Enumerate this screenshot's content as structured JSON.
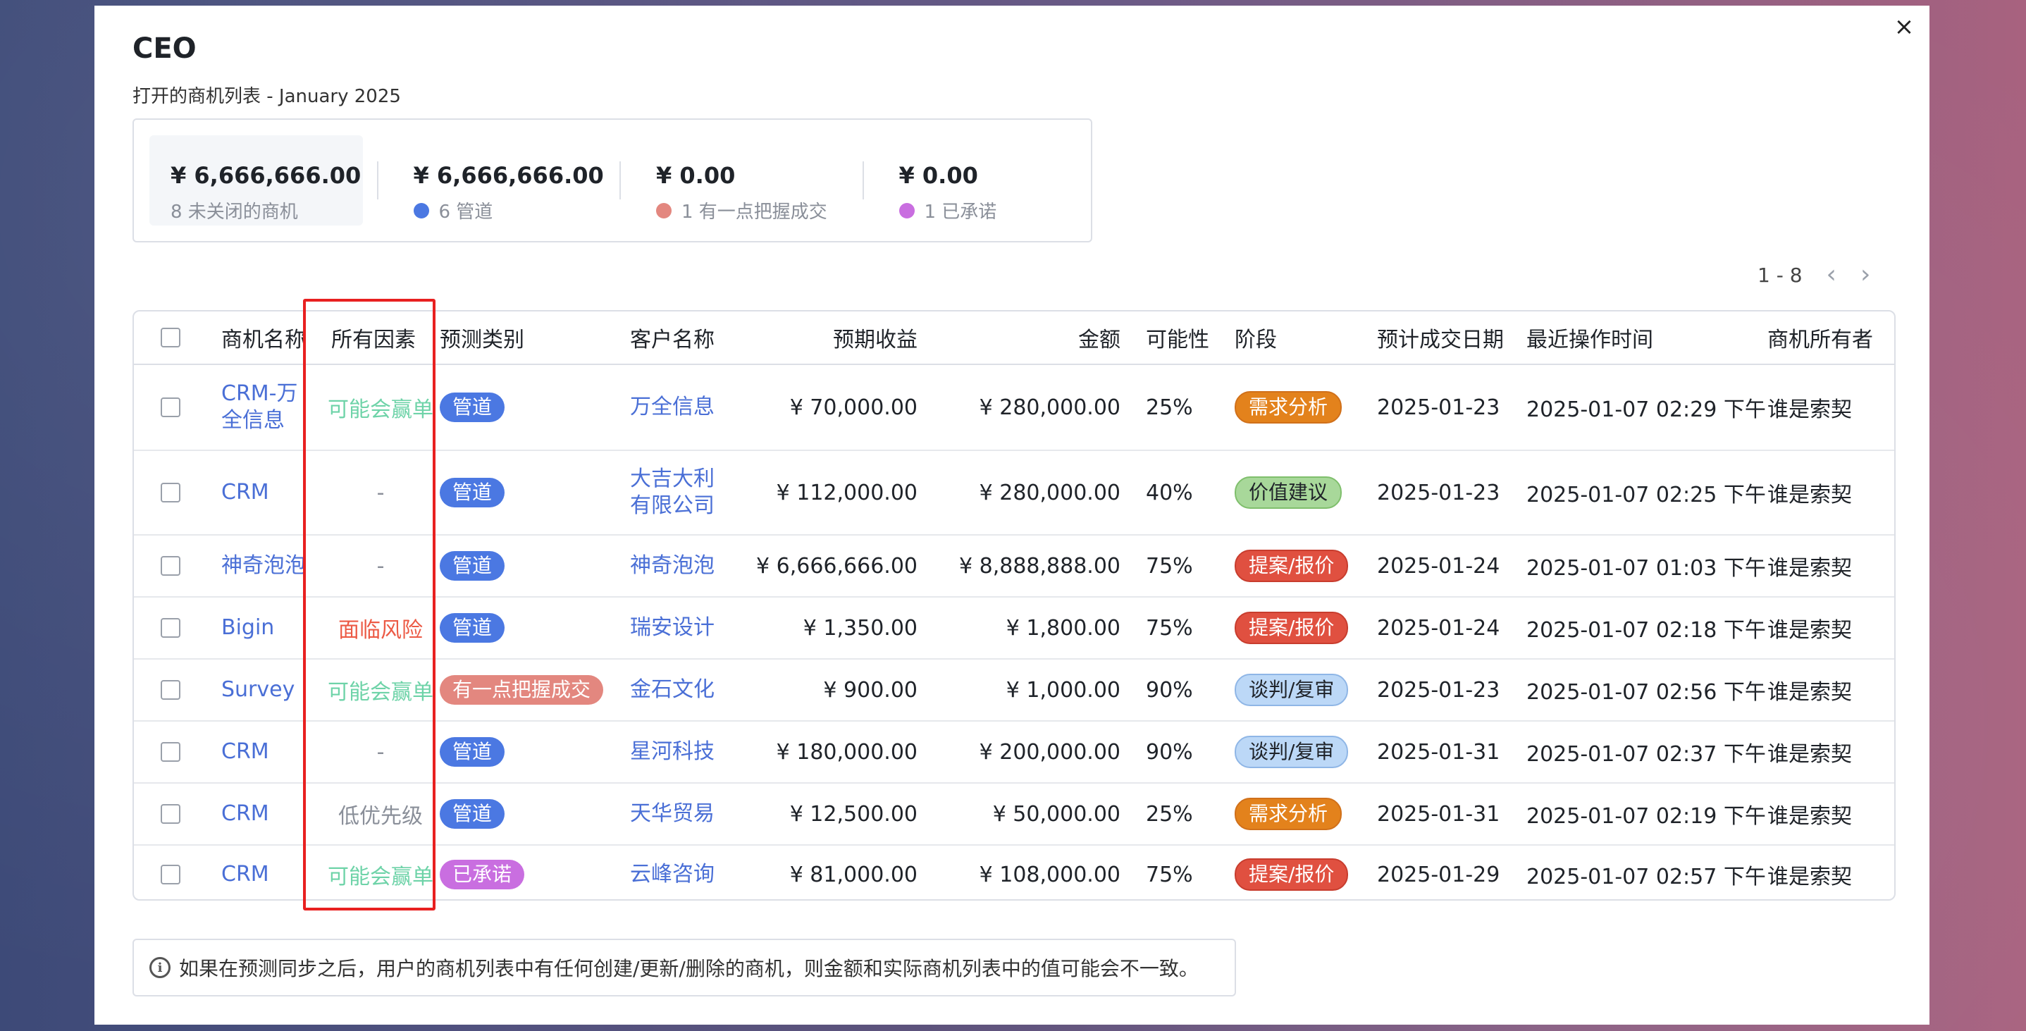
{
  "modal": {
    "title": "CEO",
    "subtitle": "打开的商机列表 - January 2025",
    "close_glyph": "×"
  },
  "summary": [
    {
      "amount": "¥ 6,666,666.00",
      "label": "8 未关闭的商机",
      "dot_color": ""
    },
    {
      "amount": "¥ 6,666,666.00",
      "label": "6 管道",
      "dot_color": "#4b78e2"
    },
    {
      "amount": "¥ 0.00",
      "label": "1 有一点把握成交",
      "dot_color": "#e3877f"
    },
    {
      "amount": "¥ 0.00",
      "label": "1 已承诺",
      "dot_color": "#c96ee0"
    }
  ],
  "pager": {
    "range": "1 - 8",
    "prev": "‹",
    "next": "›"
  },
  "table": {
    "headers": {
      "name": "商机名称",
      "factors": "所有因素",
      "forecast": "预测类别",
      "customer": "客户名称",
      "expected": "预期收益",
      "amount": "金额",
      "probability": "可能性",
      "stage": "阶段",
      "close_date": "预计成交日期",
      "last_activity": "最近操作时间",
      "owner": "商机所有者"
    },
    "rows": [
      {
        "name": "CRM-万\n全信息",
        "factor": "可能会赢单",
        "forecast": "管道",
        "customer": "万全信息",
        "expected": "¥ 70,000.00",
        "amount": "¥ 280,000.00",
        "probability": "25%",
        "stage": "需求分析",
        "close_date": "2025-01-23",
        "last_activity": "2025-01-07 02:29 下午",
        "owner": "谁是索契"
      },
      {
        "name": "CRM",
        "factor": "-",
        "forecast": "管道",
        "customer": "大吉大利\n有限公司",
        "expected": "¥ 112,000.00",
        "amount": "¥ 280,000.00",
        "probability": "40%",
        "stage": "价值建议",
        "close_date": "2025-01-23",
        "last_activity": "2025-01-07 02:25 下午",
        "owner": "谁是索契"
      },
      {
        "name": "神奇泡泡",
        "factor": "-",
        "forecast": "管道",
        "customer": "神奇泡泡",
        "expected": "¥ 6,666,666.00",
        "amount": "¥ 8,888,888.00",
        "probability": "75%",
        "stage": "提案/报价",
        "close_date": "2025-01-24",
        "last_activity": "2025-01-07 01:03 下午",
        "owner": "谁是索契"
      },
      {
        "name": "Bigin",
        "factor": "面临风险",
        "forecast": "管道",
        "customer": "瑞安设计",
        "expected": "¥ 1,350.00",
        "amount": "¥ 1,800.00",
        "probability": "75%",
        "stage": "提案/报价",
        "close_date": "2025-01-24",
        "last_activity": "2025-01-07 02:18 下午",
        "owner": "谁是索契"
      },
      {
        "name": "Survey",
        "factor": "可能会赢单",
        "forecast": "有一点把握成交",
        "customer": "金石文化",
        "expected": "¥ 900.00",
        "amount": "¥ 1,000.00",
        "probability": "90%",
        "stage": "谈判/复审",
        "close_date": "2025-01-23",
        "last_activity": "2025-01-07 02:56 下午",
        "owner": "谁是索契"
      },
      {
        "name": "CRM",
        "factor": "-",
        "forecast": "管道",
        "customer": "星河科技",
        "expected": "¥ 180,000.00",
        "amount": "¥ 200,000.00",
        "probability": "90%",
        "stage": "谈判/复审",
        "close_date": "2025-01-31",
        "last_activity": "2025-01-07 02:37 下午",
        "owner": "谁是索契"
      },
      {
        "name": "CRM",
        "factor": "低优先级",
        "forecast": "管道",
        "customer": "天华贸易",
        "expected": "¥ 12,500.00",
        "amount": "¥ 50,000.00",
        "probability": "25%",
        "stage": "需求分析",
        "close_date": "2025-01-31",
        "last_activity": "2025-01-07 02:19 下午",
        "owner": "谁是索契"
      },
      {
        "name": "CRM",
        "factor": "可能会赢单",
        "forecast": "已承诺",
        "customer": "云峰咨询",
        "expected": "¥ 81,000.00",
        "amount": "¥ 108,000.00",
        "probability": "75%",
        "stage": "提案/报价",
        "close_date": "2025-01-29",
        "last_activity": "2025-01-07 02:57 下午",
        "owner": "谁是索契"
      }
    ]
  },
  "note": {
    "text": "如果在预测同步之后，用户的商机列表中有任何创建/更新/删除的商机，则金额和实际商机列表中的值可能会不一致。",
    "icon": "i"
  },
  "colors": {
    "factor_positive": "#6ed3a8",
    "factor_risk": "#ec5a45",
    "factor_neutral": "#8a8f99",
    "forecast_pipeline": "#4b78e2",
    "forecast_best_case": "#e3877f",
    "forecast_committed": "#c96ee0",
    "stage_needs_analysis": "#e3821c",
    "stage_value_prop": "#a8d89a",
    "stage_proposal": "#e05040",
    "stage_negotiation": "#bcd8f7",
    "highlight_box": "#e82020"
  }
}
